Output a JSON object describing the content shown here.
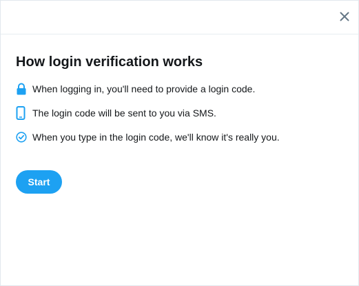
{
  "dialog": {
    "close_icon": "close-icon",
    "title": "How login verification works",
    "steps": [
      {
        "icon": "lock-icon",
        "text": "When logging in, you'll need to provide a login code."
      },
      {
        "icon": "phone-icon",
        "text": "The login code will be sent to you via SMS."
      },
      {
        "icon": "check-circle-icon",
        "text": "When you type in the login code, we'll know it's really you."
      }
    ],
    "start_label": "Start"
  },
  "colors": {
    "accent": "#1da1f2",
    "text": "#14171a",
    "close_icon": "#657786",
    "divider": "#e6ecf0"
  }
}
